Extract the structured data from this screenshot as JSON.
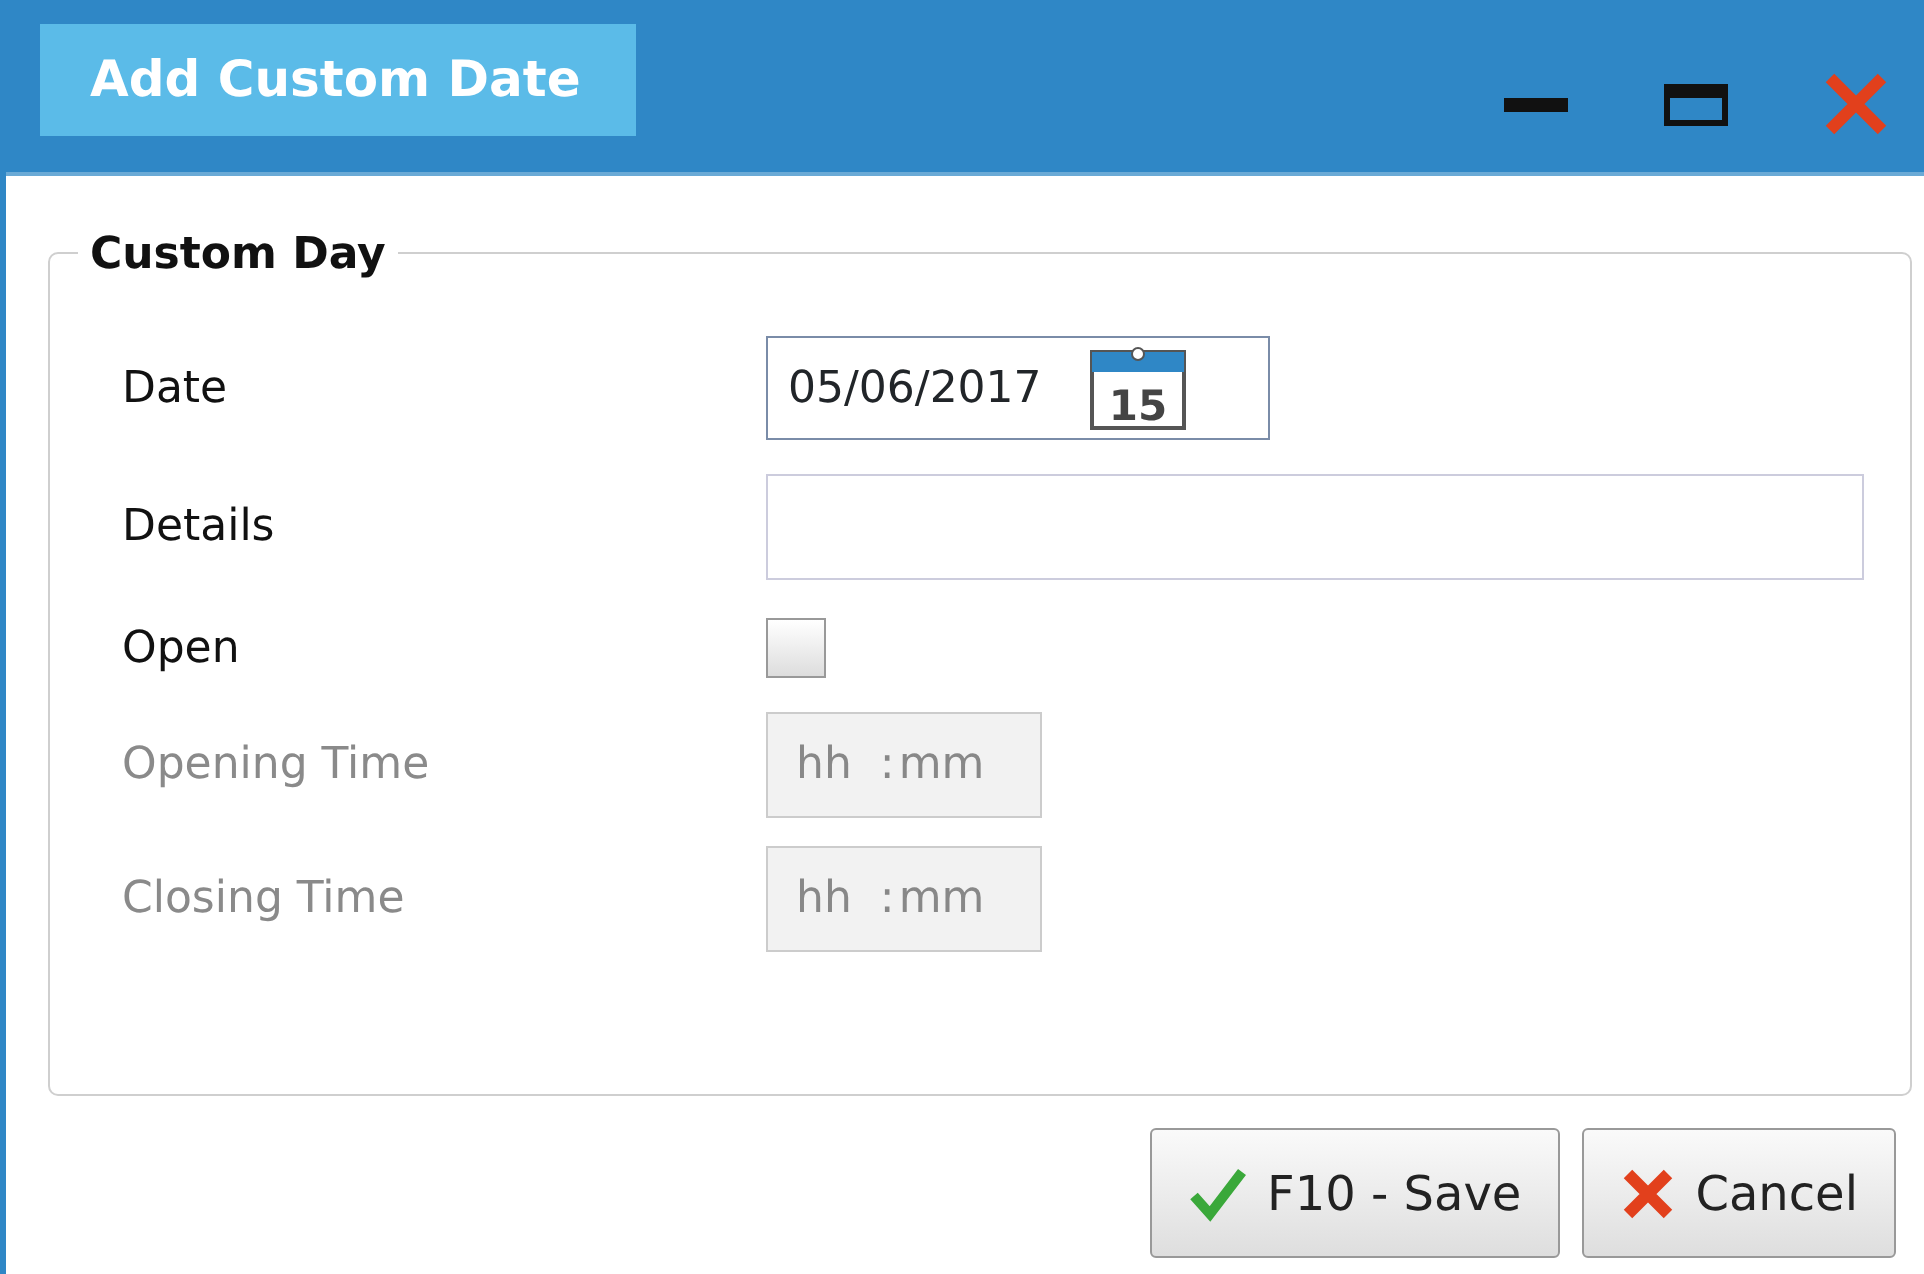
{
  "window": {
    "title": "Add Custom Date"
  },
  "title_bar_buttons": [
    {
      "kind": "minimize"
    },
    {
      "kind": "maximize"
    },
    {
      "kind": "close"
    }
  ],
  "group": {
    "title": "Custom Day",
    "fields": [
      {
        "kind": "date",
        "label": "Date",
        "value": "05/06/2017",
        "calendar_day": "15",
        "disabled": false
      },
      {
        "kind": "text",
        "label": "Details",
        "disabled": false
      },
      {
        "kind": "checkbox",
        "label": "Open",
        "checked": false,
        "disabled": false
      },
      {
        "kind": "time",
        "label": "Opening Time",
        "hour_placeholder": "hh",
        "separator": ":",
        "minute_placeholder": "mm",
        "disabled": true
      },
      {
        "kind": "time",
        "label": "Closing Time",
        "hour_placeholder": "hh",
        "separator": ":",
        "minute_placeholder": "mm",
        "disabled": true
      }
    ]
  },
  "buttons": [
    {
      "kind": "save",
      "label": "F10 - Save"
    },
    {
      "kind": "cancel",
      "label": "Cancel"
    }
  ]
}
